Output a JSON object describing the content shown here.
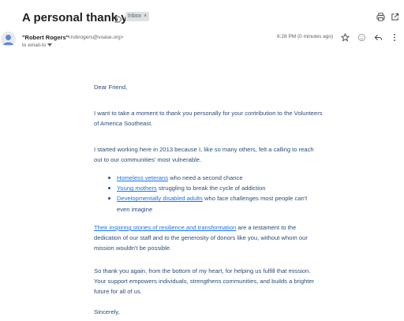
{
  "subject": "A personal thank you.",
  "label": "Inbox",
  "label_remove": "×",
  "icons": {
    "important": "important-marker-icon",
    "print": "print-icon",
    "open_new_window": "open-in-new-window-icon",
    "star": "star-icon",
    "emoji": "emoji-react-icon",
    "reply": "reply-icon",
    "more": "more-options-icon",
    "recipients_toggle": "chevron-down-icon"
  },
  "sender": {
    "name": "\"Robert Rogers\"",
    "email": "<robrogers@voase.org>",
    "to_line": "to email-to",
    "timestamp": "6:28 PM (0 minutes ago)"
  },
  "message": {
    "greeting": "Dear Friend,",
    "p1": "I want to take a moment to thank you personally for your contribution to the Volunteers of America Southeast.",
    "p2": "I started working here in 2013 because I, like so many others, felt a calling to reach out to our communities' most vulnerable.",
    "bullets": [
      {
        "link": "Homeless veterans",
        "text": " who need a second chance"
      },
      {
        "link": "Young mothers",
        "text": " struggling to break the cycle of addiction"
      },
      {
        "link": "Developmentally disabled adults",
        "text": " who face challenges most people can't even imagine"
      }
    ],
    "p3_link": "Their inspiring stories of resilience and transformation",
    "p3_text": " are a testament to the dedication of our staff and to the generosity of donors like you, without whom our mission wouldn't be possible.",
    "p4": "So thank you again, from the bottom of my heart, for helping us fulfill that mission. Your support empowers individuals, strengthens communities, and builds a brighter future for all of us.",
    "closing": "Sincerely,"
  },
  "colors": {
    "body_text": "#2c4d7a",
    "link": "#1a73e8",
    "label_bg": "#dde1e5"
  }
}
